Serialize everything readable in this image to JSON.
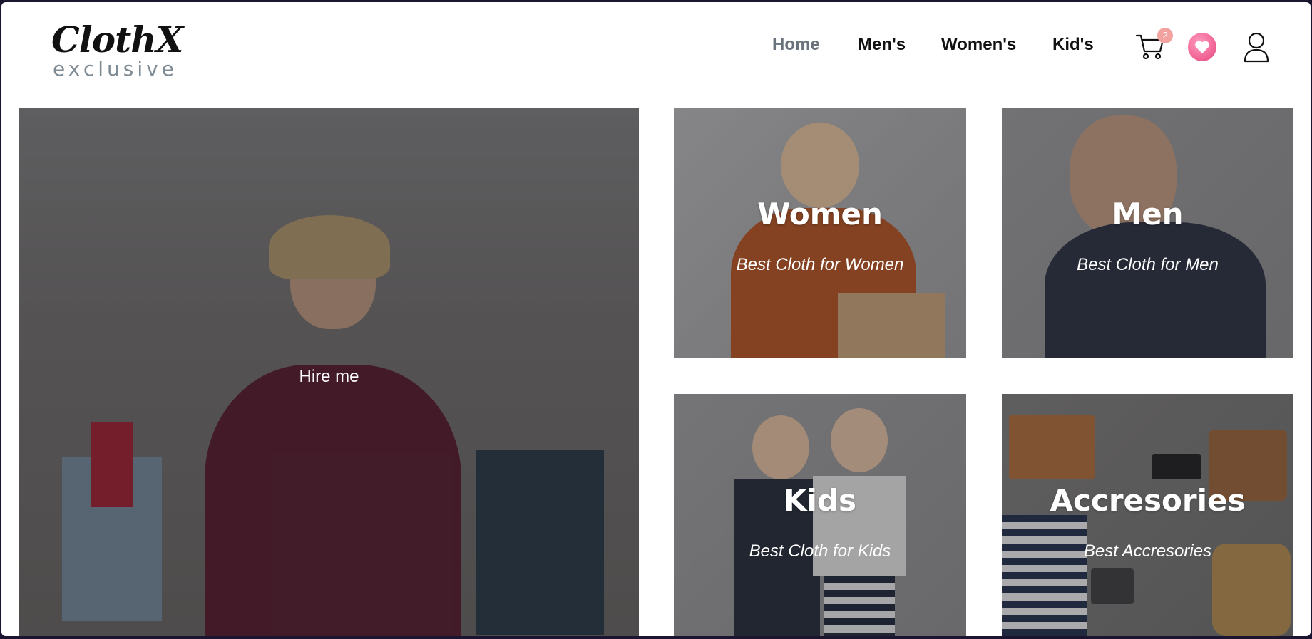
{
  "brand": {
    "name": "ClothX",
    "tagline": "exclusive"
  },
  "nav": {
    "items": [
      {
        "label": "Home",
        "active": true
      },
      {
        "label": "Men's",
        "active": false
      },
      {
        "label": "Women's",
        "active": false
      },
      {
        "label": "Kid's",
        "active": false
      }
    ]
  },
  "header_icons": {
    "cart": {
      "icon": "cart-icon",
      "count": "2"
    },
    "wishlist": {
      "icon": "heart-icon"
    },
    "account": {
      "icon": "user-icon"
    }
  },
  "hero": {
    "button_label": "Hire me"
  },
  "categories": [
    {
      "title": "Women",
      "subtitle": "Best Cloth for Women"
    },
    {
      "title": "Men",
      "subtitle": "Best Cloth for Men"
    },
    {
      "title": "Kids",
      "subtitle": "Best Cloth for Kids"
    },
    {
      "title": "Accresories",
      "subtitle": "Best Accresories"
    }
  ],
  "colors": {
    "nav_active": "#6a737b",
    "badge": "#f2a3a0",
    "heart": "#e8457e"
  }
}
